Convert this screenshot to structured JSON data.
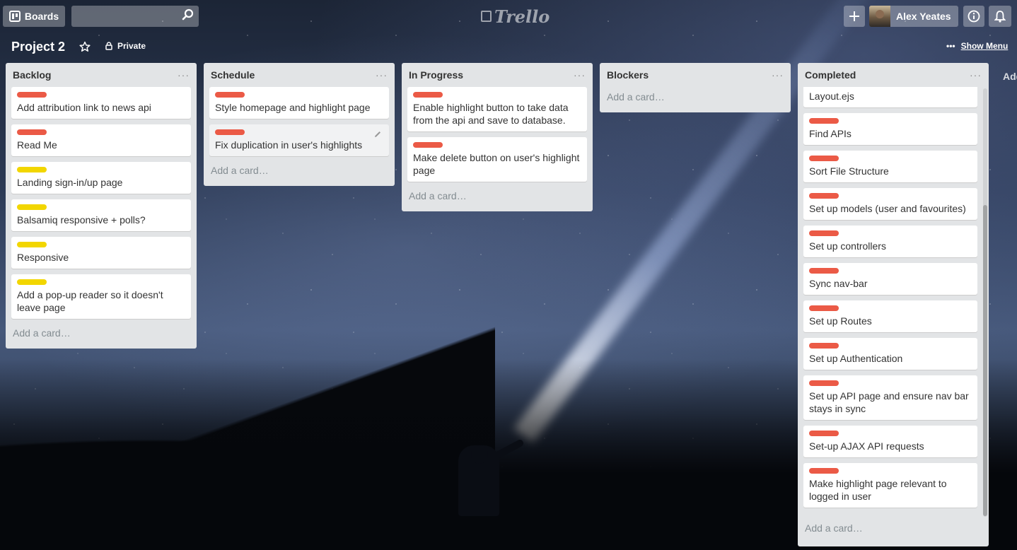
{
  "header": {
    "boards_label": "Boards",
    "search_value": "",
    "logo_text": "Trello",
    "user_name": "Alex Yeates",
    "add_icon": "plus-icon",
    "info_icon": "info-icon",
    "bell_icon": "bell-icon"
  },
  "board": {
    "title": "Project 2",
    "visibility": "Private",
    "show_menu": "Show Menu",
    "add_list_peek": "Add a list..."
  },
  "colors": {
    "label_red": "#eb5a46",
    "label_yellow": "#f2d600",
    "list_bg": "#e2e4e6"
  },
  "lists": [
    {
      "title": "Backlog",
      "cards": [
        {
          "label": "red",
          "text": "Add attribution link to news api"
        },
        {
          "label": "red",
          "text": "Read Me"
        },
        {
          "label": "yellow",
          "text": "Landing sign-in/up page"
        },
        {
          "label": "yellow",
          "text": "Balsamiq responsive + polls?"
        },
        {
          "label": "yellow",
          "text": "Responsive"
        },
        {
          "label": "yellow",
          "text": "Add a pop-up reader so it doesn't leave page"
        }
      ],
      "add_card": "Add a card…"
    },
    {
      "title": "Schedule",
      "cards": [
        {
          "label": "red",
          "text": "Style homepage and highlight page"
        },
        {
          "label": "red",
          "text": "Fix duplication in user's highlights"
        }
      ],
      "add_card": "Add a card…"
    },
    {
      "title": "In Progress",
      "cards": [
        {
          "label": "red",
          "text": "Enable highlight button to take data from the api and save to database."
        },
        {
          "label": "red",
          "text": "Make delete button on user's highlight page"
        }
      ],
      "add_card": "Add a card…"
    },
    {
      "title": "Blockers",
      "cards": [],
      "add_card": "Add a card…"
    },
    {
      "title": "Completed",
      "cards": [
        {
          "label": "red",
          "text": "Layout.ejs"
        },
        {
          "label": "red",
          "text": "Find APIs"
        },
        {
          "label": "red",
          "text": "Sort File Structure"
        },
        {
          "label": "red",
          "text": "Set up models (user and favourites)"
        },
        {
          "label": "red",
          "text": "Set up controllers"
        },
        {
          "label": "red",
          "text": "Sync nav-bar"
        },
        {
          "label": "red",
          "text": "Set up Routes"
        },
        {
          "label": "red",
          "text": "Set up Authentication"
        },
        {
          "label": "red",
          "text": "Set up API page and ensure nav bar stays in sync"
        },
        {
          "label": "red",
          "text": "Set-up AJAX API requests"
        },
        {
          "label": "red",
          "text": "Make highlight page relevant to logged in user"
        }
      ],
      "add_card": "Add a card…"
    }
  ]
}
